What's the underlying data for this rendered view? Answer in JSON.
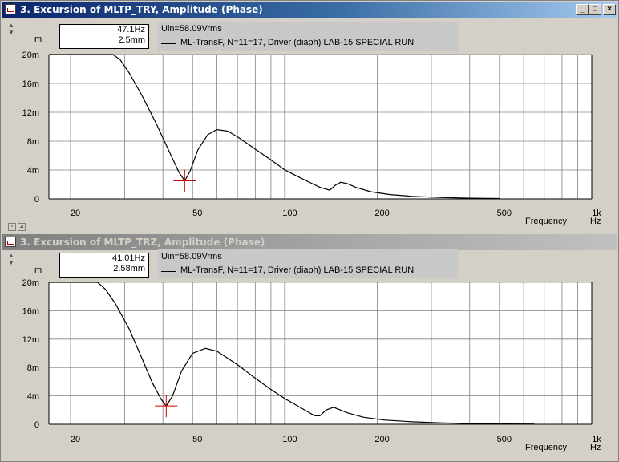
{
  "windows": [
    {
      "title": "3. Excursion of MLTP_TRY, Amplitude (Phase)",
      "active": true,
      "cursor": {
        "freq": "47.1Hz",
        "value": "2.5mm"
      },
      "legend": {
        "uin": "Uin=58.09Vrms",
        "series": "ML-TransF, N=11=17, Driver (diaph) LAB-15 SPECIAL RUN"
      },
      "y_unit": "m",
      "x_label": "Frequency",
      "x_unit": "Hz"
    },
    {
      "title": "3. Excursion of MLTP_TRZ, Amplitude (Phase)",
      "active": false,
      "cursor": {
        "freq": "41.01Hz",
        "value": "2.58mm"
      },
      "legend": {
        "uin": "Uin=58.09Vrms",
        "series": "ML-TransF, N=11=17, Driver (diaph) LAB-15 SPECIAL RUN"
      },
      "y_unit": "m",
      "x_label": "Frequency",
      "x_unit": "Hz"
    }
  ],
  "title_buttons": {
    "minimize": "_",
    "maximize": "□",
    "close": "×"
  },
  "chart_data": [
    {
      "type": "line",
      "x_scale": "log",
      "xlim": [
        17,
        1000
      ],
      "ylim": [
        0,
        20
      ],
      "x_ticks": [
        "20",
        "50",
        "100",
        "200",
        "500",
        "1k"
      ],
      "x_tick_values": [
        20,
        50,
        100,
        200,
        500,
        1000
      ],
      "y_ticks": [
        "0",
        "4m",
        "8m",
        "12m",
        "16m",
        "20m"
      ],
      "y_tick_values": [
        0,
        4,
        8,
        12,
        16,
        20
      ],
      "y_scale_note": "millimetres shown as m-prefix (m = milli)",
      "cursor_point": [
        47.1,
        2.5
      ],
      "series": [
        {
          "color": "#000000",
          "x": [
            17,
            27.5,
            29,
            31,
            34,
            38,
            42,
            45,
            47.1,
            49,
            52,
            56,
            60,
            65,
            70,
            80,
            90,
            100,
            115,
            130,
            140,
            146,
            152,
            160,
            170,
            190,
            220,
            260,
            320,
            400,
            500
          ],
          "y": [
            20,
            20,
            19.3,
            17.5,
            14.5,
            10.5,
            6.5,
            3.8,
            2.5,
            3.8,
            6.8,
            8.9,
            9.6,
            9.4,
            8.6,
            6.9,
            5.4,
            4.0,
            2.7,
            1.6,
            1.2,
            1.9,
            2.3,
            2.1,
            1.6,
            1.0,
            0.6,
            0.35,
            0.2,
            0.1,
            0.06
          ]
        }
      ]
    },
    {
      "type": "line",
      "x_scale": "log",
      "xlim": [
        17,
        1000
      ],
      "ylim": [
        0,
        20
      ],
      "x_ticks": [
        "20",
        "50",
        "100",
        "200",
        "500",
        "1k"
      ],
      "x_tick_values": [
        20,
        50,
        100,
        200,
        500,
        1000
      ],
      "y_ticks": [
        "0",
        "4m",
        "8m",
        "12m",
        "16m",
        "20m"
      ],
      "y_tick_values": [
        0,
        4,
        8,
        12,
        16,
        20
      ],
      "cursor_point": [
        41.01,
        2.58
      ],
      "series": [
        {
          "color": "#000000",
          "x": [
            17,
            24.5,
            26,
            28,
            31,
            34,
            37,
            39.5,
            41.01,
            43,
            46,
            50,
            55,
            60,
            70,
            80,
            90,
            100,
            115,
            125,
            130,
            136,
            144,
            160,
            180,
            210,
            260,
            320,
            400,
            500,
            650
          ],
          "y": [
            20,
            20,
            19,
            17,
            13.5,
            9.5,
            5.8,
            3.5,
            2.58,
            4.0,
            7.5,
            10.0,
            10.7,
            10.3,
            8.4,
            6.5,
            4.9,
            3.6,
            2.1,
            1.2,
            1.2,
            2.0,
            2.4,
            1.6,
            1.0,
            0.6,
            0.35,
            0.2,
            0.1,
            0.06,
            0.03
          ]
        }
      ]
    }
  ]
}
